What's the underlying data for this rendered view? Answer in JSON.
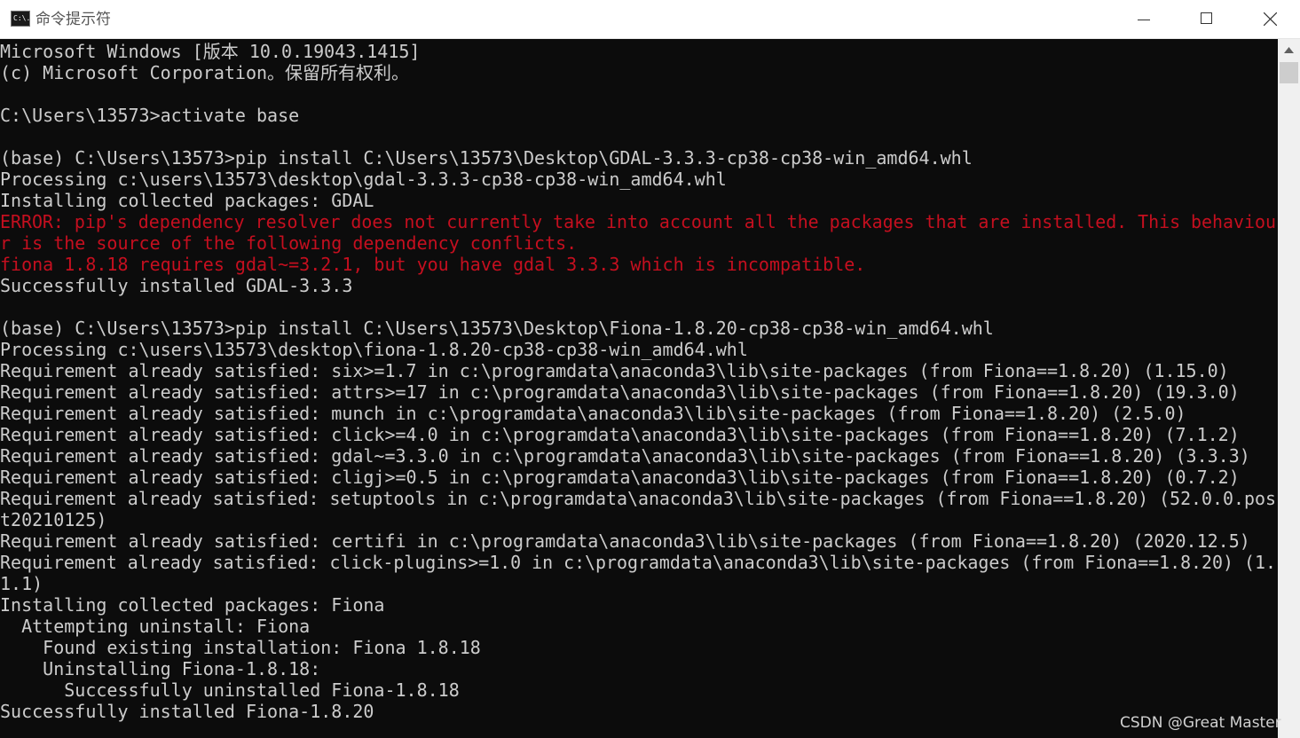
{
  "window": {
    "title": "命令提示符",
    "icon": "cmd-icon",
    "icon_text": "C:\\."
  },
  "console": {
    "lines": [
      {
        "text": "Microsoft Windows [版本 10.0.19043.1415]",
        "type": "normal"
      },
      {
        "text": "(c) Microsoft Corporation。保留所有权利。",
        "type": "normal"
      },
      {
        "text": "",
        "type": "normal"
      },
      {
        "text": "C:\\Users\\13573>activate base",
        "type": "normal"
      },
      {
        "text": "",
        "type": "normal"
      },
      {
        "text": "(base) C:\\Users\\13573>pip install C:\\Users\\13573\\Desktop\\GDAL-3.3.3-cp38-cp38-win_amd64.whl",
        "type": "normal"
      },
      {
        "text": "Processing c:\\users\\13573\\desktop\\gdal-3.3.3-cp38-cp38-win_amd64.whl",
        "type": "normal"
      },
      {
        "text": "Installing collected packages: GDAL",
        "type": "normal"
      },
      {
        "text": "ERROR: pip's dependency resolver does not currently take into account all the packages that are installed. This behaviou",
        "type": "error"
      },
      {
        "text": "r is the source of the following dependency conflicts.",
        "type": "error"
      },
      {
        "text": "fiona 1.8.18 requires gdal~=3.2.1, but you have gdal 3.3.3 which is incompatible.",
        "type": "error"
      },
      {
        "text": "Successfully installed GDAL-3.3.3",
        "type": "normal"
      },
      {
        "text": "",
        "type": "normal"
      },
      {
        "text": "(base) C:\\Users\\13573>pip install C:\\Users\\13573\\Desktop\\Fiona-1.8.20-cp38-cp38-win_amd64.whl",
        "type": "normal"
      },
      {
        "text": "Processing c:\\users\\13573\\desktop\\fiona-1.8.20-cp38-cp38-win_amd64.whl",
        "type": "normal"
      },
      {
        "text": "Requirement already satisfied: six>=1.7 in c:\\programdata\\anaconda3\\lib\\site-packages (from Fiona==1.8.20) (1.15.0)",
        "type": "normal"
      },
      {
        "text": "Requirement already satisfied: attrs>=17 in c:\\programdata\\anaconda3\\lib\\site-packages (from Fiona==1.8.20) (19.3.0)",
        "type": "normal"
      },
      {
        "text": "Requirement already satisfied: munch in c:\\programdata\\anaconda3\\lib\\site-packages (from Fiona==1.8.20) (2.5.0)",
        "type": "normal"
      },
      {
        "text": "Requirement already satisfied: click>=4.0 in c:\\programdata\\anaconda3\\lib\\site-packages (from Fiona==1.8.20) (7.1.2)",
        "type": "normal"
      },
      {
        "text": "Requirement already satisfied: gdal~=3.3.0 in c:\\programdata\\anaconda3\\lib\\site-packages (from Fiona==1.8.20) (3.3.3)",
        "type": "normal"
      },
      {
        "text": "Requirement already satisfied: cligj>=0.5 in c:\\programdata\\anaconda3\\lib\\site-packages (from Fiona==1.8.20) (0.7.2)",
        "type": "normal"
      },
      {
        "text": "Requirement already satisfied: setuptools in c:\\programdata\\anaconda3\\lib\\site-packages (from Fiona==1.8.20) (52.0.0.pos",
        "type": "normal"
      },
      {
        "text": "t20210125)",
        "type": "normal"
      },
      {
        "text": "Requirement already satisfied: certifi in c:\\programdata\\anaconda3\\lib\\site-packages (from Fiona==1.8.20) (2020.12.5)",
        "type": "normal"
      },
      {
        "text": "Requirement already satisfied: click-plugins>=1.0 in c:\\programdata\\anaconda3\\lib\\site-packages (from Fiona==1.8.20) (1.",
        "type": "normal"
      },
      {
        "text": "1.1)",
        "type": "normal"
      },
      {
        "text": "Installing collected packages: Fiona",
        "type": "normal"
      },
      {
        "text": "  Attempting uninstall: Fiona",
        "type": "normal"
      },
      {
        "text": "    Found existing installation: Fiona 1.8.18",
        "type": "normal"
      },
      {
        "text": "    Uninstalling Fiona-1.8.18:",
        "type": "normal"
      },
      {
        "text": "      Successfully uninstalled Fiona-1.8.18",
        "type": "normal"
      },
      {
        "text": "Successfully installed Fiona-1.8.20",
        "type": "normal"
      }
    ]
  },
  "watermark": "CSDN @Great Master",
  "colors": {
    "background": "#0c0c0c",
    "text": "#cccccc",
    "error": "#c50f1f"
  },
  "controls": {
    "minimize": "minimize-icon",
    "maximize": "maximize-icon",
    "close": "close-icon",
    "scroll_up": "scroll-up-arrow-icon"
  }
}
